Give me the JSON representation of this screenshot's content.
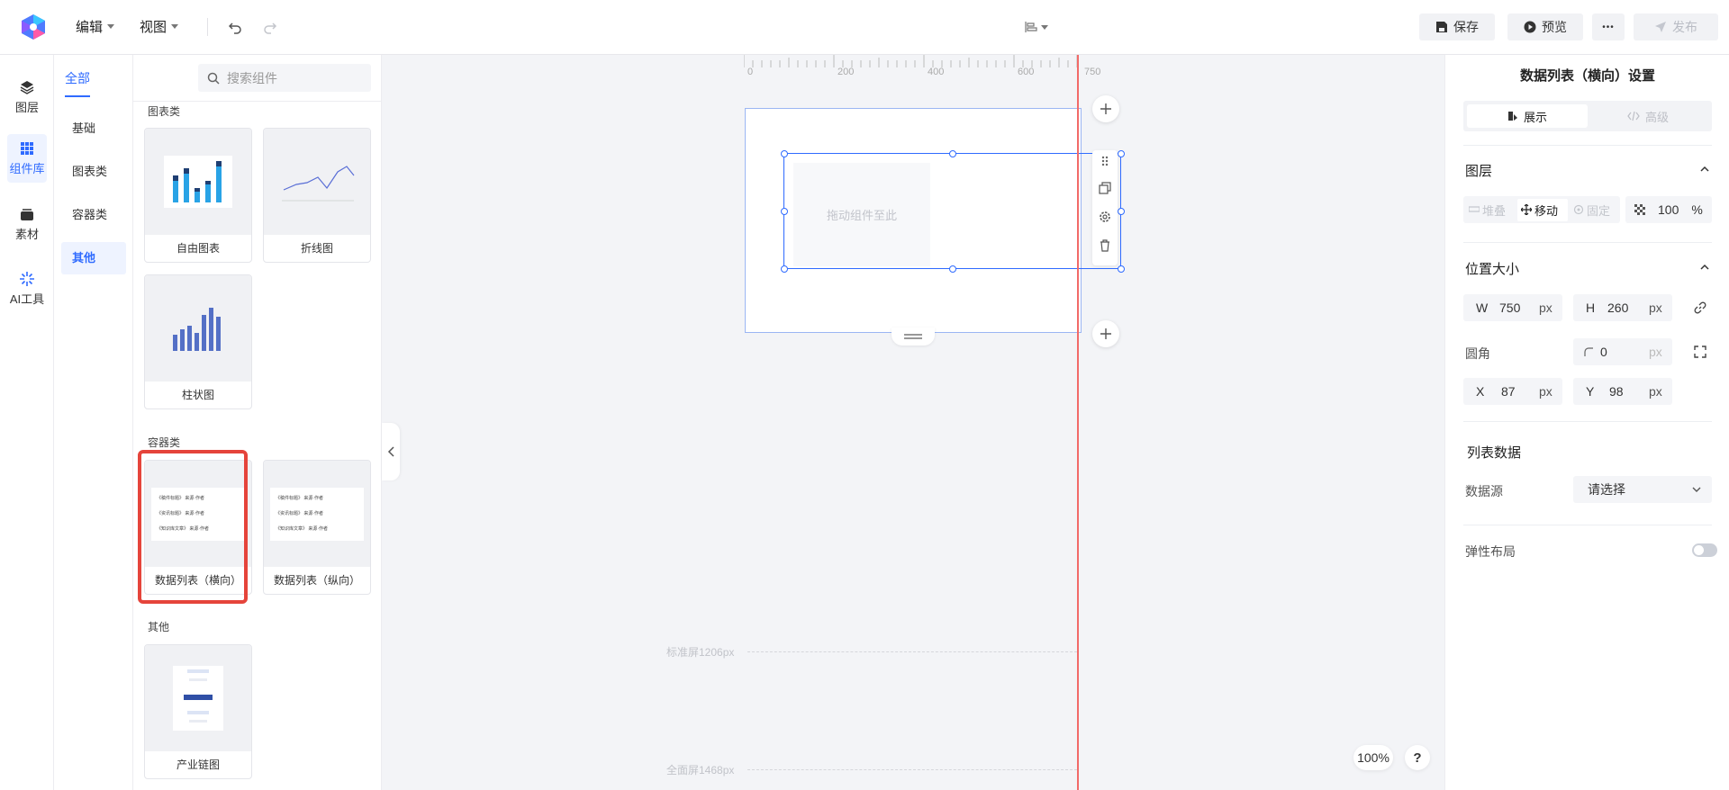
{
  "header": {
    "edit_menu": "编辑",
    "view_menu": "视图",
    "save": "保存",
    "preview": "预览",
    "more": "•••",
    "publish": "发布"
  },
  "rail": [
    {
      "label": "图层",
      "icon": "layers-icon"
    },
    {
      "label": "组件库",
      "icon": "grid-icon"
    },
    {
      "label": "素材",
      "icon": "assets-icon"
    },
    {
      "label": "AI工具",
      "icon": "ai-sparkle-icon"
    }
  ],
  "categories": {
    "all": "全部",
    "items": [
      "基础",
      "图表类",
      "容器类",
      "其他"
    ]
  },
  "search": {
    "placeholder": "搜索组件"
  },
  "components": {
    "chart_section": "图表类",
    "container_section": "容器类",
    "other_section": "其他",
    "cards": {
      "free_chart": "自由图表",
      "line_chart": "折线图",
      "bar_chart": "柱状图",
      "list_h": "数据列表（横向）",
      "list_v": "数据列表（纵向）",
      "chain": "产业链图"
    },
    "list_preview_rows": [
      "《稿件标题》 来源·作者",
      "《资讯标题》 来源·作者",
      "《知识库文章》 来源·作者"
    ]
  },
  "canvas": {
    "ruler": [
      "0",
      "200",
      "400",
      "600",
      "750"
    ],
    "drop_hint": "拖动组件至此",
    "standard_screen": "标准屏1206px",
    "full_screen": "全面屏1468px",
    "zoom": "100%",
    "help": "?"
  },
  "settings": {
    "title": "数据列表（横向）设置",
    "tab_display": "展示",
    "tab_advanced": "高级",
    "layer_section": "图层",
    "layer_opts": [
      "堆叠",
      "移动",
      "固定"
    ],
    "opacity": "100",
    "opacity_unit": "%",
    "size_section": "位置大小",
    "w_label": "W",
    "w_value": "750",
    "h_label": "H",
    "h_value": "260",
    "unit": "px",
    "radius_label": "圆角",
    "radius_value": "0",
    "x_label": "X",
    "x_value": "87",
    "y_label": "Y",
    "y_value": "98",
    "list_data_section": "列表数据",
    "source_label": "数据源",
    "source_placeholder": "请选择",
    "flex_layout_label": "弹性布局"
  },
  "colors": {
    "accent": "#2f6bff",
    "highlight": "#e5443b",
    "guide": "#f26a68"
  }
}
